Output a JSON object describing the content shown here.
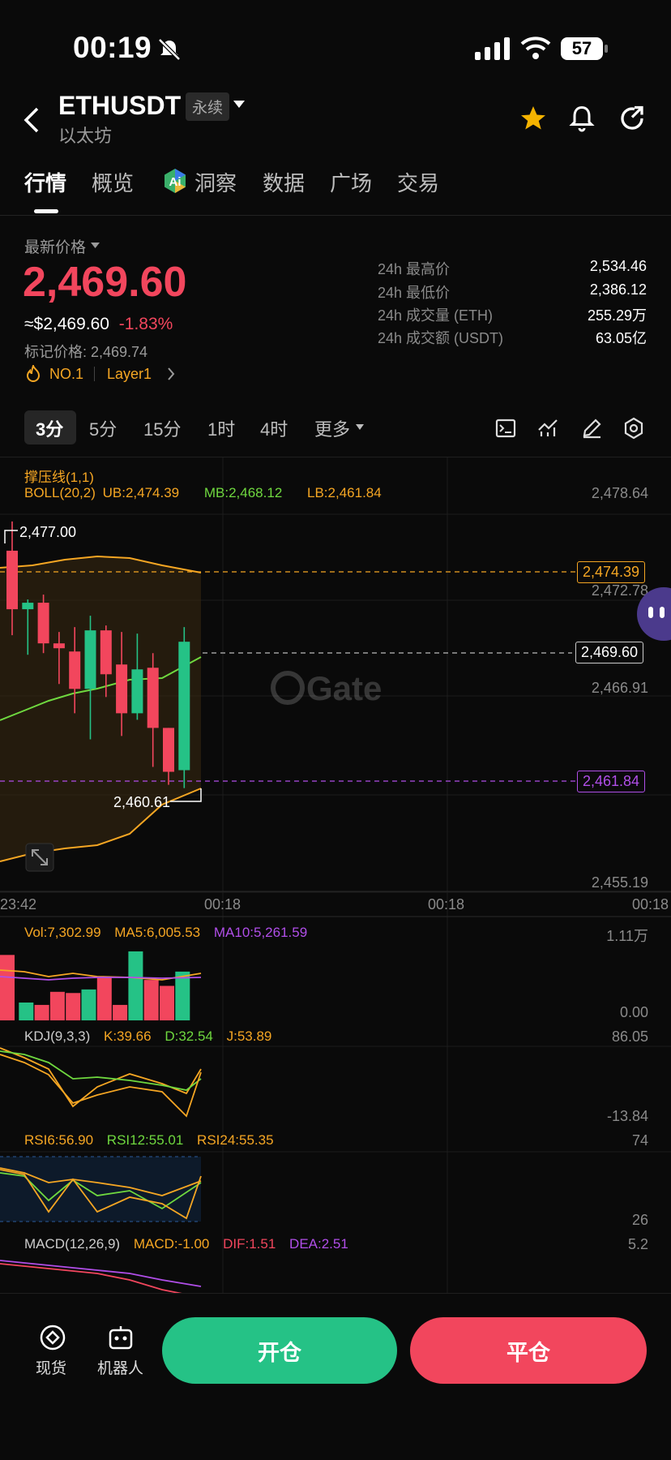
{
  "status_bar": {
    "time": "00:19",
    "battery": "57"
  },
  "header": {
    "symbol": "ETHUSDT",
    "contract_type": "永续",
    "name": "以太坊"
  },
  "tabs": [
    {
      "label": "行情",
      "active": true
    },
    {
      "label": "概览"
    },
    {
      "label": "洞察"
    },
    {
      "label": "数据"
    },
    {
      "label": "广场"
    },
    {
      "label": "交易"
    }
  ],
  "price": {
    "label": "最新价格",
    "last": "2,469.60",
    "usd": "≈$2,469.60",
    "change": "-1.83%",
    "mark": "标记价格: 2,469.74",
    "rank": "NO.1",
    "category": "Layer1"
  },
  "stats": [
    {
      "label": "24h 最高价",
      "value": "2,534.46"
    },
    {
      "label": "24h 最低价",
      "value": "2,386.12"
    },
    {
      "label": "24h 成交量 (ETH)",
      "value": "255.29万"
    },
    {
      "label": "24h 成交额 (USDT)",
      "value": "63.05亿"
    }
  ],
  "intervals": [
    "3分",
    "5分",
    "15分",
    "1时",
    "4时",
    "更多"
  ],
  "chart_data": {
    "type": "candlestick",
    "overlay_title": "撑压线(1,1)",
    "boll": {
      "label": "BOLL(20,2)",
      "ub": "UB:2,474.39",
      "mb": "MB:2,468.12",
      "lb": "LB:2,461.84"
    },
    "y_axis": [
      "2,478.64",
      "2,472.78",
      "2,466.91",
      "2,455.19"
    ],
    "x_axis": [
      "23:42",
      "00:18",
      "00:18",
      "00:18"
    ],
    "tags": {
      "upper": "2,474.39",
      "last": "2,469.60",
      "lower": "2,461.84",
      "high": "2,477.00",
      "low": "2,460.61"
    },
    "watermark": "Gate",
    "ylim": [
      2455.19,
      2478.64
    ],
    "candles": [
      {
        "o": 2475.2,
        "h": 2477.0,
        "l": 2470.0,
        "c": 2471.6
      },
      {
        "o": 2471.6,
        "h": 2472.2,
        "l": 2468.8,
        "c": 2472.0
      },
      {
        "o": 2472.0,
        "h": 2472.5,
        "l": 2468.9,
        "c": 2469.5
      },
      {
        "o": 2469.5,
        "h": 2470.2,
        "l": 2467.0,
        "c": 2469.2
      },
      {
        "o": 2469.0,
        "h": 2470.5,
        "l": 2465.2,
        "c": 2466.7
      },
      {
        "o": 2466.7,
        "h": 2471.2,
        "l": 2463.6,
        "c": 2470.3
      },
      {
        "o": 2470.3,
        "h": 2470.6,
        "l": 2466.2,
        "c": 2467.6
      },
      {
        "o": 2468.2,
        "h": 2470.2,
        "l": 2463.8,
        "c": 2465.2
      },
      {
        "o": 2465.2,
        "h": 2470.1,
        "l": 2464.8,
        "c": 2467.9
      },
      {
        "o": 2468.0,
        "h": 2468.9,
        "l": 2461.9,
        "c": 2464.3
      },
      {
        "o": 2464.3,
        "h": 2464.3,
        "l": 2460.8,
        "c": 2461.6
      },
      {
        "o": 2461.7,
        "h": 2470.5,
        "l": 2460.6,
        "c": 2469.6
      }
    ],
    "volume": {
      "vol": "Vol:7,302.99",
      "ma5": "MA5:6,005.53",
      "ma10": "MA10:5,261.59",
      "top": "1.11万",
      "bottom": "0.00",
      "values": [
        5.5,
        1.5,
        1.3,
        2.4,
        2.3,
        2.6,
        3.6,
        1.3,
        5.8,
        3.4,
        2.9,
        4.1
      ]
    },
    "kdj": {
      "label": "KDJ(9,3,3)",
      "k": "K:39.66",
      "d": "D:32.54",
      "j": "J:53.89",
      "top": "86.05",
      "bottom": "-13.84"
    },
    "rsi": {
      "r6": "RSI6:56.90",
      "r12": "RSI12:55.01",
      "r24": "RSI24:55.35",
      "top": "74",
      "bottom": "26"
    },
    "macd": {
      "label": "MACD(12,26,9)",
      "macd": "MACD:-1.00",
      "dif": "DIF:1.51",
      "dea": "DEA:2.51",
      "top": "5.2"
    }
  },
  "bottom_bar": {
    "spot": "现货",
    "robot": "机器人",
    "open": "开仓",
    "close": "平仓"
  },
  "colors": {
    "up": "#25c286",
    "down": "#f2465d",
    "boll_upper": "#f5a623",
    "boll_mid": "#6fd83f",
    "purple": "#b04ee8"
  }
}
